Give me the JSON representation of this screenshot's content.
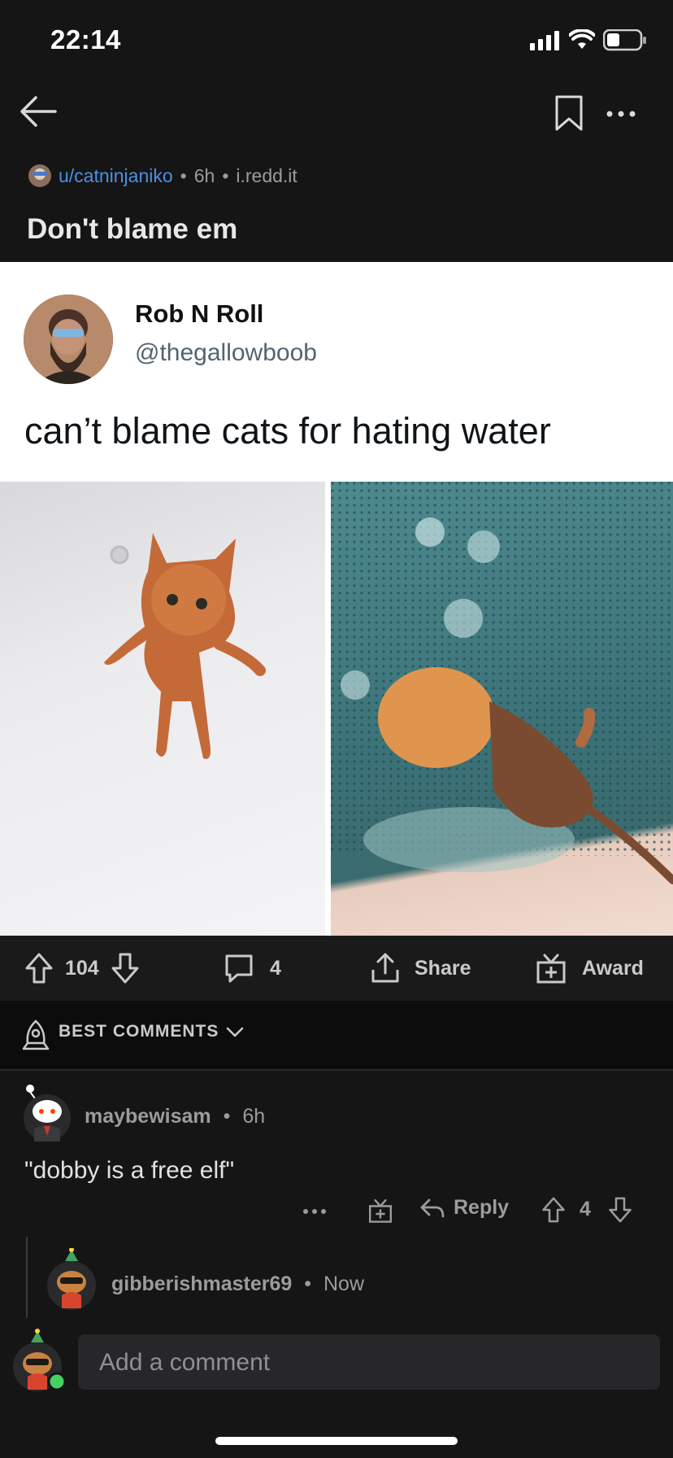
{
  "status_bar": {
    "time": "22:14"
  },
  "post": {
    "author": "u/catninjaniko",
    "age": "6h",
    "domain": "i.redd.it",
    "title": "Don't blame em",
    "tweet": {
      "name": "Rob N Roll",
      "handle": "@thegallowboob",
      "text": "can’t blame cats for hating water"
    }
  },
  "actions": {
    "upvotes": "104",
    "comments": "4",
    "share_label": "Share",
    "award_label": "Award"
  },
  "sort": {
    "label": "BEST COMMENTS"
  },
  "comments": [
    {
      "user": "maybewisam",
      "age": "6h",
      "text": "\"dobby is a free elf\"",
      "reply_label": "Reply",
      "score": "4"
    }
  ],
  "reply_in_progress": {
    "user": "gibberishmaster69",
    "age": "Now"
  },
  "composer": {
    "placeholder": "Add a comment"
  },
  "colors": {
    "background": "#151516",
    "link": "#4d8fe0",
    "text": "#d7dadc"
  }
}
